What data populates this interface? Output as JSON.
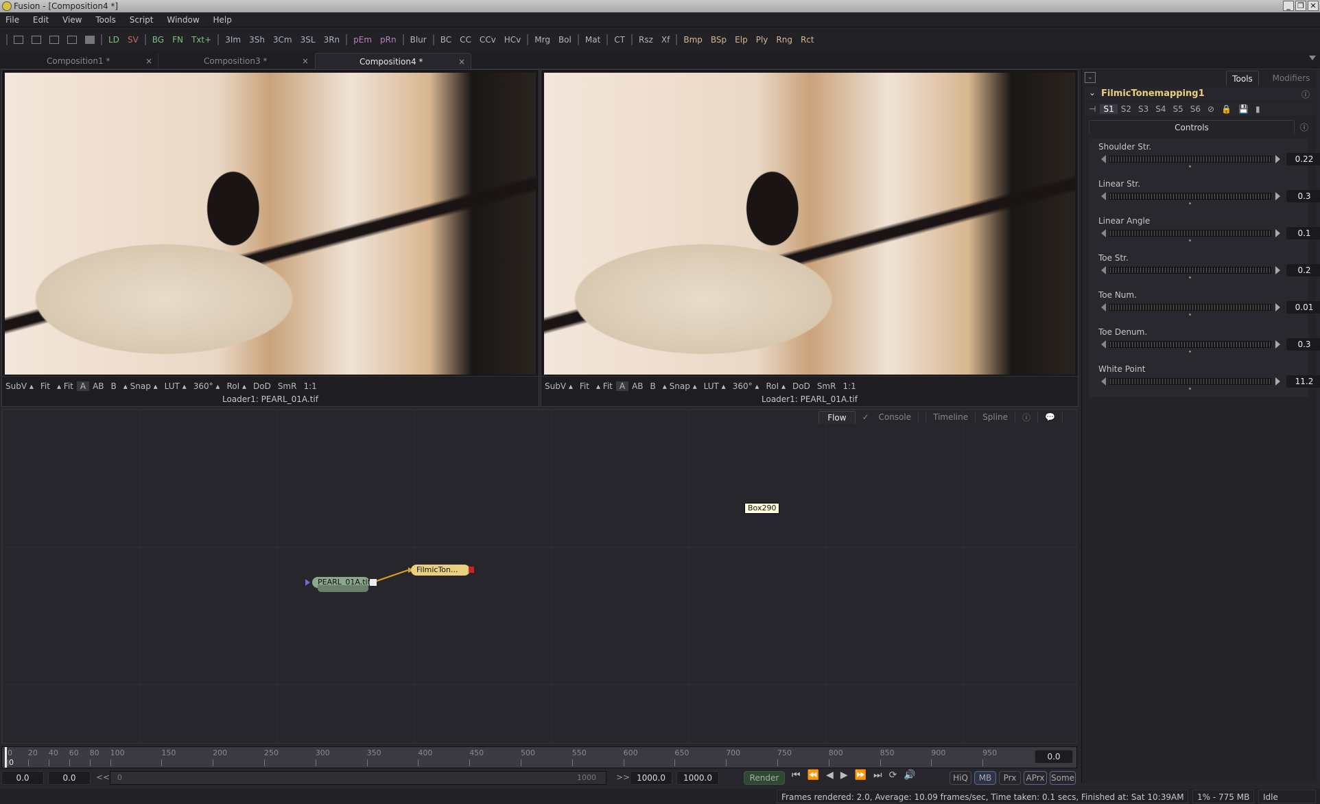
{
  "window": {
    "title": "Fusion - [Composition4 *]",
    "minimize": "_",
    "restore": "❐",
    "close": "✕"
  },
  "menu": [
    "File",
    "Edit",
    "View",
    "Tools",
    "Script",
    "Window",
    "Help"
  ],
  "toolbar": {
    "layout_icons": [
      "layout-1-icon",
      "layout-2-icon",
      "layout-3-icon",
      "layout-4-icon",
      "layout-stack-icon"
    ],
    "groups": [
      [
        {
          "label": "LD",
          "color": "#7ec07e"
        },
        {
          "label": "SV",
          "color": "#c86a6a"
        }
      ],
      [
        {
          "label": "BG",
          "color": "#7ec07e"
        },
        {
          "label": "FN",
          "color": "#7ec07e"
        },
        {
          "label": "Txt+",
          "color": "#7ec07e"
        }
      ],
      [
        {
          "label": "3Im",
          "color": "#a9b3c6"
        },
        {
          "label": "3Sh",
          "color": "#a9b3c6"
        },
        {
          "label": "3Cm",
          "color": "#a9b3c6"
        },
        {
          "label": "3SL",
          "color": "#a9b3c6"
        },
        {
          "label": "3Rn",
          "color": "#a9b3c6"
        }
      ],
      [
        {
          "label": "pEm",
          "color": "#c07ec0"
        },
        {
          "label": "pRn",
          "color": "#c07ec0"
        }
      ],
      [
        {
          "label": "Blur",
          "color": "#b4b4bc"
        }
      ],
      [
        {
          "label": "BC",
          "color": "#b4b4bc"
        },
        {
          "label": "CC",
          "color": "#b4b4bc"
        },
        {
          "label": "CCv",
          "color": "#b4b4bc"
        },
        {
          "label": "HCv",
          "color": "#b4b4bc"
        }
      ],
      [
        {
          "label": "Mrg",
          "color": "#b4b4bc"
        },
        {
          "label": "Bol",
          "color": "#b4b4bc"
        }
      ],
      [
        {
          "label": "Mat",
          "color": "#b4b4bc"
        }
      ],
      [
        {
          "label": "CT",
          "color": "#b4b4bc"
        }
      ],
      [
        {
          "label": "Rsz",
          "color": "#b4b4bc"
        },
        {
          "label": "Xf",
          "color": "#b4b4bc"
        }
      ],
      [
        {
          "label": "Bmp",
          "color": "#d8b890"
        },
        {
          "label": "BSp",
          "color": "#d8b890"
        },
        {
          "label": "Elp",
          "color": "#d8b890"
        },
        {
          "label": "Ply",
          "color": "#d8b890"
        },
        {
          "label": "Rng",
          "color": "#d8b890"
        },
        {
          "label": "Rct",
          "color": "#d8b890"
        }
      ]
    ]
  },
  "tabs": [
    {
      "label": "Composition1 *",
      "active": false
    },
    {
      "label": "Composition3 *",
      "active": false
    },
    {
      "label": "Composition4 *",
      "active": true
    }
  ],
  "tab_close": "×",
  "viewer_toolbar": {
    "items": [
      "SubV ▴",
      "Fit",
      "▴ Fit",
      "A",
      "AB",
      "B",
      "▴ Snap ▴",
      "LUT ▴",
      "360° ▴",
      "RoI ▴",
      "DoD",
      "SmR",
      "1:1"
    ],
    "caption": "Loader1: PEARL_01A.tif"
  },
  "viewers": [
    {
      "caption": "Loader1: PEARL_01A.tif"
    },
    {
      "caption": "Loader1: PEARL_01A.tif"
    }
  ],
  "flow": {
    "tabs": [
      "Flow",
      "Console",
      "Timeline",
      "Spline"
    ],
    "active_tab": "Flow",
    "nodes": [
      {
        "label": "PEARL_01A.tif",
        "color": "#7e9a7e"
      },
      {
        "label": "FilmicTon...",
        "color": "#e8d080"
      }
    ],
    "tooltip": "Box290"
  },
  "right_panel": {
    "tabs": [
      "Tools",
      "Modifiers"
    ],
    "active_tab": "Tools",
    "tool_name": "FilmicTonemapping1",
    "versions": [
      "S1",
      "S2",
      "S3",
      "S4",
      "S5",
      "S6"
    ],
    "active_version": "S1",
    "section": "Controls",
    "controls": [
      {
        "label": "Shoulder Str.",
        "value": "0.22"
      },
      {
        "label": "Linear Str.",
        "value": "0.3"
      },
      {
        "label": "Linear Angle",
        "value": "0.1"
      },
      {
        "label": "Toe Str.",
        "value": "0.2"
      },
      {
        "label": "Toe Num.",
        "value": "0.01"
      },
      {
        "label": "Toe Denum.",
        "value": "0.3"
      },
      {
        "label": "White Point",
        "value": "11.2"
      }
    ]
  },
  "timeline": {
    "ticks": [
      "0",
      "20",
      "40",
      "60",
      "80",
      "100",
      "150",
      "200",
      "250",
      "300",
      "350",
      "400",
      "450",
      "500",
      "550",
      "600",
      "650",
      "700",
      "750",
      "800",
      "850",
      "900",
      "950"
    ],
    "current_frame_marker": "0",
    "current_time": "0.0"
  },
  "transport": {
    "global_start": "0.0",
    "render_start": "0.0",
    "rewind_label": "<<",
    "range_start": "0",
    "range_end": "1000",
    "forward_label": ">>",
    "render_end": "1000.0",
    "global_end": "1000.0",
    "render_button": "Render",
    "buttons": [
      "HiQ",
      "MB",
      "Prx",
      "APrx",
      "Some"
    ]
  },
  "status": {
    "message": "Frames rendered: 2.0,  Average: 10.09 frames/sec,  Time taken: 0.1 secs,  Finished at: Sat 10:39AM",
    "memory": "1% -  775 MB",
    "state": "Idle"
  }
}
